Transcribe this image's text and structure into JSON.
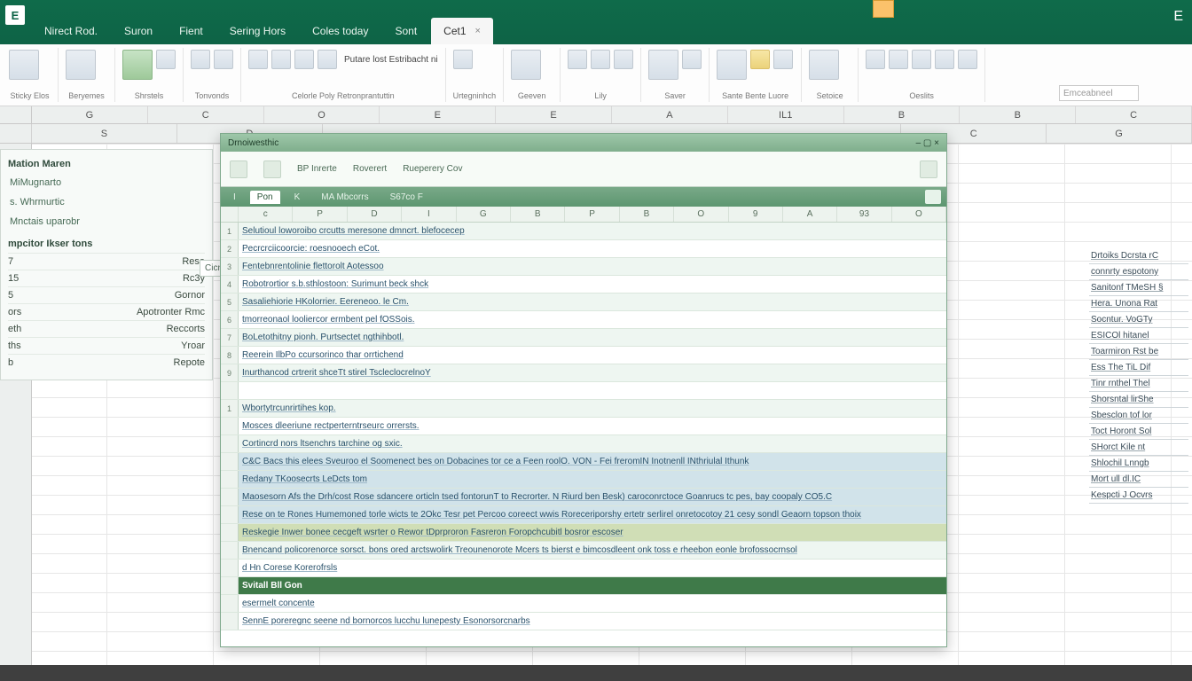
{
  "app": {
    "letter": "E",
    "right_letter": "E"
  },
  "tabs": [
    {
      "label": "Nirect Rod."
    },
    {
      "label": "Suron"
    },
    {
      "label": "Fient"
    },
    {
      "label": "Sering Hors"
    },
    {
      "label": "Coles today"
    },
    {
      "label": "Sont"
    },
    {
      "label": "Cet1",
      "active": true,
      "close": "×"
    }
  ],
  "ribbon_groups": [
    {
      "label": "Sticky Elos",
      "text": ""
    },
    {
      "label": "Beryemes",
      "text": ""
    },
    {
      "label": "Shrstels",
      "text": ""
    },
    {
      "label": "Tonvonds",
      "text": ""
    },
    {
      "label": "Celorle Poly Retronprantuttin",
      "text": "Putare lost Estribacht ni"
    },
    {
      "label": "Urtegninhch",
      "text": ""
    },
    {
      "label": "Geeven",
      "text": ""
    },
    {
      "label": "Lily",
      "text": ""
    },
    {
      "label": "Saver",
      "text": ""
    },
    {
      "label": "Sante Bente Luore",
      "text": ""
    },
    {
      "label": "Setoice",
      "text": ""
    },
    {
      "label": "Oeslits",
      "text": ""
    }
  ],
  "searchbox_placeholder": "Emceabneel",
  "outer_col_letters_top": [
    "G",
    "C",
    "O",
    "E",
    "E",
    "A",
    "IL1",
    "B",
    "B",
    "C"
  ],
  "outer_col_letters_band": [
    "S",
    "D",
    "",
    "",
    "",
    "",
    "",
    "",
    "",
    "C",
    "G"
  ],
  "side_panel": {
    "headers": [
      "Mation Maren",
      "MiMugnarto",
      "s. Whrmurtic",
      "Mnctais uparobr"
    ],
    "section_title": "mpcitor Ikser tons",
    "rows": [
      {
        "k": "7",
        "v": "Rese"
      },
      {
        "k": "15",
        "v": "Rc3y"
      },
      {
        "k": "5",
        "v": "Gornor"
      },
      {
        "k": "ors",
        "v": "Apotronter Rmc"
      },
      {
        "k": "eth",
        "v": "Reccorts"
      },
      {
        "k": "ths",
        "v": "Yroar"
      },
      {
        "k": "b",
        "v": "Repote"
      }
    ],
    "choice_label": "Cicnony Joono"
  },
  "right_notes": [
    "Drtoiks Dcrsta rC",
    "connrty  espotony",
    "Sanitonf TMeSH §",
    "Hera. Unona Rat",
    "Socntur. VoGTy",
    "ESICOl hitanel",
    "Toarmiron Rst be",
    "Ess The TiL Dif",
    "Tinr rnthel Thel",
    "Shorsntal lirShe",
    "Sbesclon tof lor",
    "Toct Horont Sol",
    "SHorct Kile nt",
    "Shlochil Lnngb",
    "Mort ull dl.IC",
    "Kespcti J Ocvrs"
  ],
  "inner": {
    "title_left": "Drnoiwesthic",
    "title_right": "",
    "ribbon_items": [
      "",
      "BP Inrerte",
      "Roverert",
      "Rueperery Cov",
      ""
    ],
    "tabbar": {
      "items": [
        "I",
        "Pon",
        "K",
        "MA Mbcorrs",
        "S67co F"
      ],
      "current": 1
    },
    "cols": [
      "",
      "c",
      "P",
      "D",
      "I",
      "G",
      "B",
      "P",
      "B",
      "O",
      "9",
      "A",
      "93",
      "O"
    ],
    "rows": [
      {
        "n": "1",
        "t": "Selutioul loworoibo crcutts  meresone dmncrt. blefocecep",
        "cls": "alt"
      },
      {
        "n": "2",
        "t": "Pecrcrciicoorcie: roesnooech eCot."
      },
      {
        "n": "3",
        "t": "Fentebnrentolinie flettorolt Aotessoo",
        "cls": "alt"
      },
      {
        "n": "4",
        "t": "Robotrortior s.b.sthlostoon: Surimunt beck shck"
      },
      {
        "n": "5",
        "t": "Sasaliehiorie HKolorrier.  Eereneoo. le Cm.",
        "cls": "alt"
      },
      {
        "n": "6",
        "t": "tmorreonaol looliercor ermbent pel fOSSois."
      },
      {
        "n": "7",
        "t": "BoLetothitny pionh. Purtsectet ngthihbotl.",
        "cls": "alt"
      },
      {
        "n": "8",
        "t": "Reerein IlbPo ccursorinco thar orrtichend"
      },
      {
        "n": "9",
        "t": "Inurthancod crtrerit shceTt stirel  TscleclocrelnoY",
        "cls": "alt"
      },
      {
        "n": "",
        "t": ""
      },
      {
        "n": "1",
        "t": "Wbortytrcunrirtihes kop.",
        "cls": "alt"
      },
      {
        "n": "",
        "t": "Mosces dleeriune rectperterntrseurc orrersts."
      },
      {
        "n": "",
        "t": "Cortincrd nors ltsenchrs tarchine og sxic.",
        "cls": "alt"
      },
      {
        "n": "",
        "t": "C&C Bacs this elees Sveuroo el Soomenect  bes on   Dobacines tor ce a Feen roolO. VON   - Fei freromIN Inotnenll   INthriulal Ithunk",
        "cls": "sel"
      },
      {
        "n": "",
        "t": "Redany TKoosecrts LeDcts tom",
        "cls": "sel"
      },
      {
        "n": "",
        "t": "Maosesorn Afs the Drh/cost Rose sdancere orticln tsed fontorunT to Recrorter.  N Riurd ben Besk) caroconrctoce  Goanrucs tc pes, bay coopaly CO5.C",
        "cls": "sel"
      },
      {
        "n": "",
        "t": "Rese on te Rones Humemoned torle  wicts te 2Okc Tesr pet Percoo coreect wwis Roreceriporshy ertetr  serlirel onretocotoy 21 cesy sondl Geaorn topson thoix",
        "cls": "sel"
      },
      {
        "n": "",
        "t": "Reskegie Inwer bonee cecgeft wsrter o Rewor tDprproron Fasreron           Foropchcubitl bosror escoser",
        "cls": "greenband"
      },
      {
        "n": "",
        "t": "Bnencand policorenorce sorsct.   bons ored arctswolirk Treounenorote   Mcers ts bierst e  bimcosdleent onk toss e rheebon eonle brofossocrnsol",
        "cls": "alt"
      },
      {
        "n": "",
        "t": "                     d Hn   Corese Korerofrsls"
      },
      {
        "n": "",
        "t": "Svitall        Bll Gon",
        "cls": "dkgreen"
      },
      {
        "n": "",
        "t": "esermelt concente"
      },
      {
        "n": "",
        "t": "SennE poreregnc seene nd bornorcos lucchu   lunepesty Esonorsorcnarbs"
      }
    ]
  }
}
